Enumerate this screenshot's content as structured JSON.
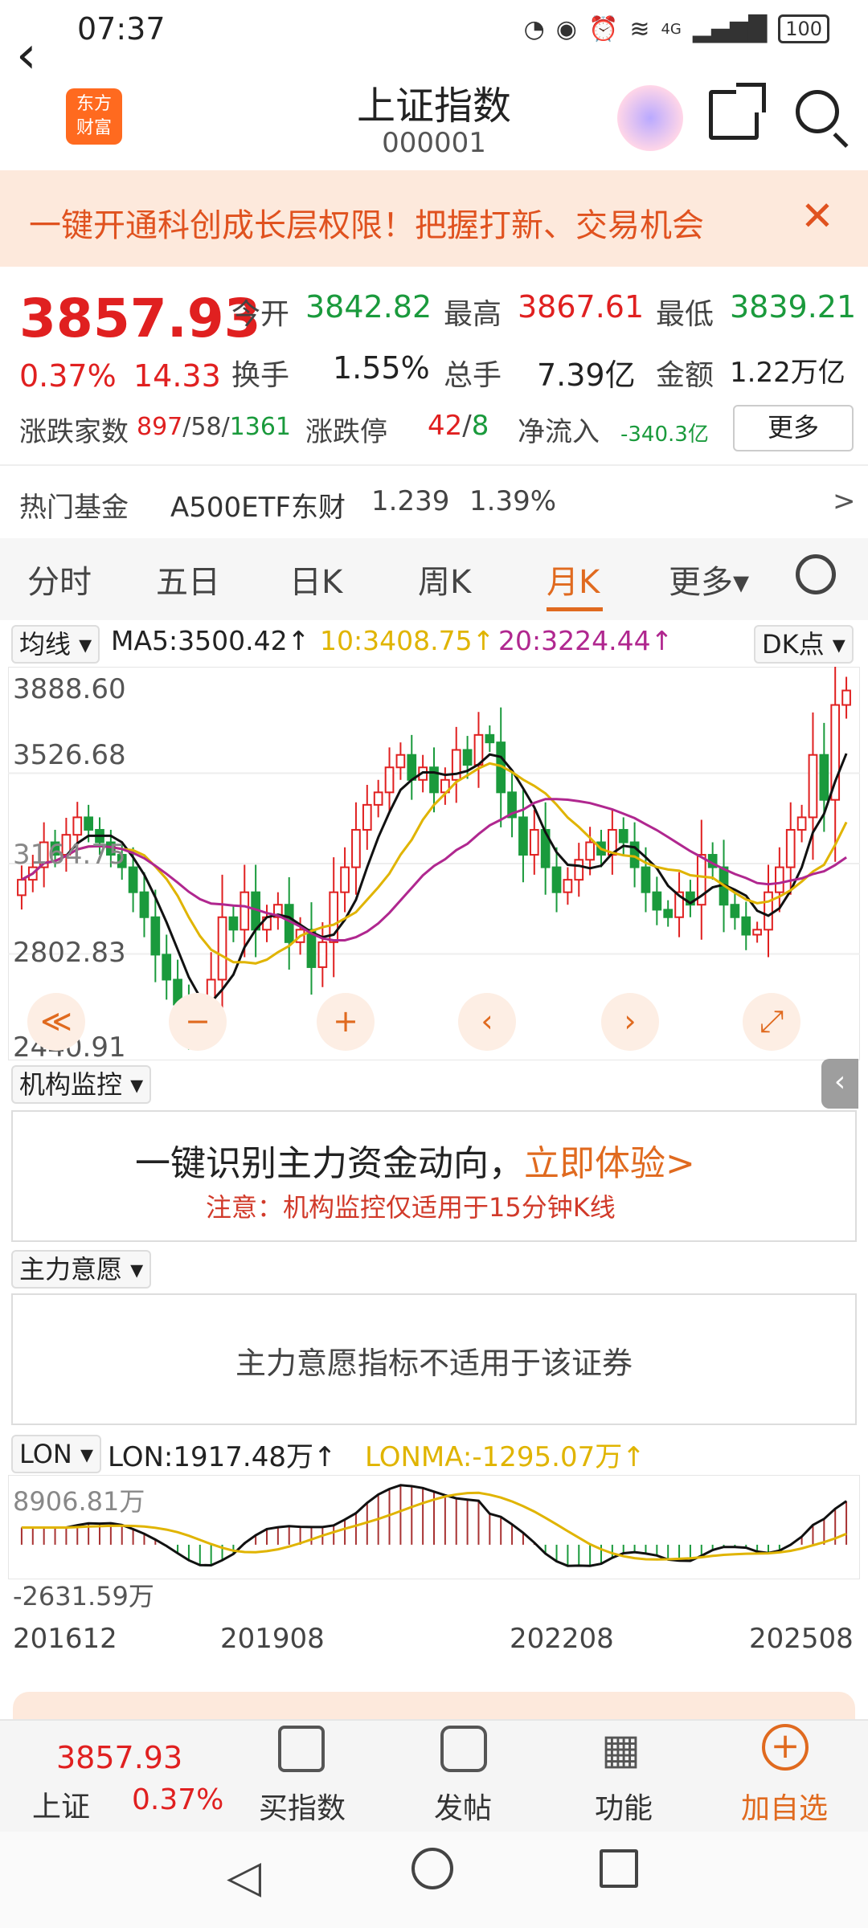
{
  "status_bar": {
    "time": "07:37",
    "battery": "100",
    "network": "4G"
  },
  "header": {
    "title": "上证指数",
    "code": "000001",
    "logo_text_1": "东方",
    "logo_text_2": "财富"
  },
  "banner": {
    "text": "一键开通科创成长层权限！把握打新、交易机会",
    "close": "✕"
  },
  "quote": {
    "price": "3857.93",
    "change_pct": "0.37%",
    "change": "14.33",
    "open_label": "今开",
    "open": "3842.82",
    "high_label": "最高",
    "high": "3867.61",
    "low_label": "最低",
    "low": "3839.21",
    "turnover_label": "换手",
    "turnover": "1.55%",
    "volume_label": "总手",
    "volume": "7.39亿",
    "amount_label": "金额",
    "amount": "1.22万亿",
    "breadth_label": "涨跌家数",
    "up": "897",
    "flat": "58",
    "down": "1361",
    "limit_label": "涨跌停",
    "limit_up": "42",
    "limit_down": "8",
    "inflow_label": "净流入",
    "inflow": "-340.3亿",
    "more_button": "更多"
  },
  "hot_fund": {
    "label": "热门基金",
    "name": "A500ETF东财",
    "price": "1.239",
    "pct": "1.39%",
    "arrow": ">"
  },
  "tabs": [
    "分时",
    "五日",
    "日K",
    "周K",
    "月K",
    "更多▾"
  ],
  "active_tab": "月K",
  "ma_legend": {
    "selector": "均线 ▾",
    "ma5": "MA5:3500.42↑",
    "ma10": "10:3408.75↑",
    "ma20": "20:3224.44↑",
    "dk": "DK点 ▾"
  },
  "kline_axis": {
    "y1": "3888.60",
    "y2": "3526.68",
    "y3": "3164.75",
    "y4": "2802.83",
    "y5": "2440.91"
  },
  "kline_nav": {
    "first": "≪",
    "zoom_out": "−",
    "zoom_in": "+",
    "prev": "‹",
    "next": "›",
    "expand": "⤢"
  },
  "institution": {
    "selector": "机构监控 ▾",
    "headline": "一键识别主力资金动向，",
    "cta": "立即体验>",
    "note": "注意：机构监控仅适用于15分钟K线"
  },
  "intent": {
    "selector": "主力意愿 ▾",
    "message": "主力意愿指标不适用于该证券"
  },
  "lon": {
    "selector": "LON ▾",
    "lon": "LON:1917.48万↑",
    "lonma": "LONMA:-1295.07万↑",
    "y_top": "8906.81万",
    "y_bottom": "-2631.59万"
  },
  "x_axis": [
    "201612",
    "201908",
    "202208",
    "202508"
  ],
  "bottom_nav": {
    "index_price": "3857.93",
    "index_name": "上证",
    "index_pct": "0.37%",
    "buy": "买指数",
    "post": "发帖",
    "func": "功能",
    "add": "加自选"
  },
  "colors": {
    "up": "#e02020",
    "down": "#1a9a3c",
    "ma5": "#111111",
    "ma10": "#e0b400",
    "ma20": "#b0278f",
    "accent": "#e06a1f"
  },
  "chart_data": {
    "type": "candlestick",
    "period": "monthly",
    "y_range": [
      2440.91,
      3888.6
    ],
    "close_series": [
      3100,
      3150,
      3250,
      3200,
      3280,
      3350,
      3300,
      3250,
      3200,
      3150,
      3050,
      2950,
      2800,
      2700,
      2600,
      2500,
      2550,
      2700,
      2950,
      2900,
      3050,
      2900,
      2950,
      3000,
      2850,
      2900,
      2750,
      2850,
      3050,
      3150,
      3300,
      3400,
      3450,
      3550,
      3600,
      3500,
      3550,
      3450,
      3500,
      3620,
      3560,
      3680,
      3650,
      3450,
      3350,
      3200,
      3300,
      3150,
      3050,
      3100,
      3180,
      3250,
      3200,
      3300,
      3250,
      3150,
      3050,
      2980,
      2950,
      3050,
      3000,
      3200,
      3150,
      3000,
      2950,
      2880,
      2900,
      3050,
      3150,
      3300,
      3350,
      3600,
      3420,
      3800,
      3857.93
    ],
    "ma_latest": {
      "MA5": 3500.42,
      "MA10": 3408.75,
      "MA20": 3224.44
    }
  }
}
